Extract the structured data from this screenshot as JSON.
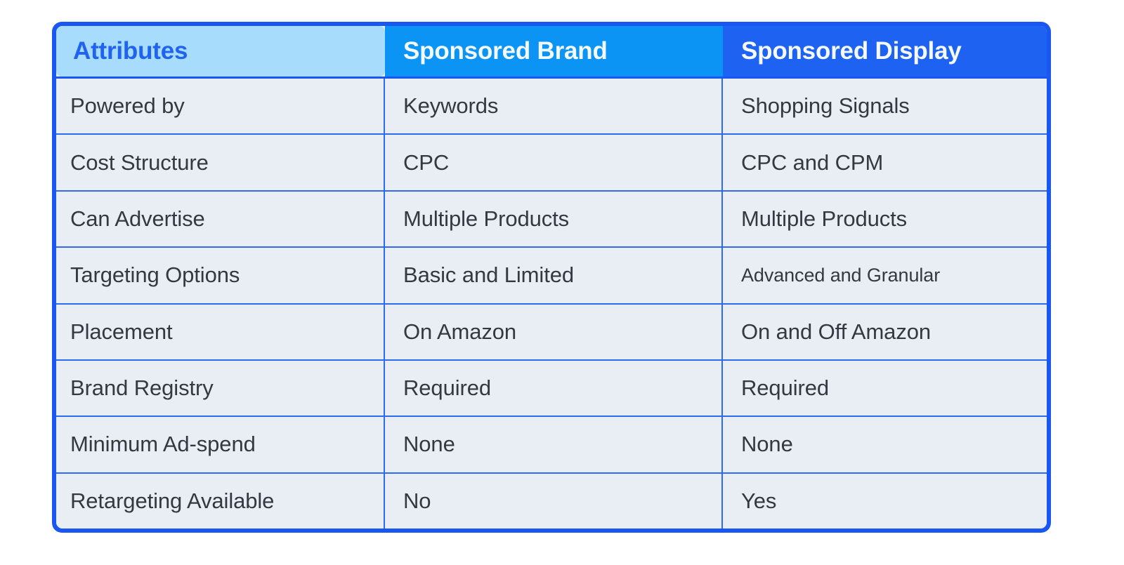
{
  "table": {
    "columns": [
      {
        "key": "attributes",
        "label": "Attributes"
      },
      {
        "key": "sponsored_brand",
        "label": "Sponsored Brand"
      },
      {
        "key": "sponsored_display",
        "label": "Sponsored Display"
      }
    ],
    "rows": [
      {
        "attribute": "Powered by",
        "sponsored_brand": "Keywords",
        "sponsored_display": "Shopping Signals"
      },
      {
        "attribute": "Cost Structure",
        "sponsored_brand": "CPC",
        "sponsored_display": "CPC and CPM"
      },
      {
        "attribute": "Can Advertise",
        "sponsored_brand": "Multiple Products",
        "sponsored_display": "Multiple Products"
      },
      {
        "attribute": "Targeting Options",
        "sponsored_brand": "Basic and Limited",
        "sponsored_display": "Advanced and Granular"
      },
      {
        "attribute": "Placement",
        "sponsored_brand": "On Amazon",
        "sponsored_display": "On and Off Amazon"
      },
      {
        "attribute": "Brand Registry",
        "sponsored_brand": "Required",
        "sponsored_display": "Required"
      },
      {
        "attribute": "Minimum Ad-spend",
        "sponsored_brand": "None",
        "sponsored_display": "None"
      },
      {
        "attribute": "Retargeting Available",
        "sponsored_brand": "No",
        "sponsored_display": "Yes"
      }
    ]
  },
  "colors": {
    "border": "#1a56f2",
    "header_attributes_bg": "#a8dcfd",
    "header_attributes_text": "#1f63f0",
    "header_brand_bg": "#0c94f5",
    "header_display_bg": "#1d62f1",
    "header_text": "#f2f9ff",
    "row_bg": "#e9edf4",
    "row_divider": "#2f6bf2",
    "body_text": "#343940",
    "page_bg": "#ffffff"
  }
}
